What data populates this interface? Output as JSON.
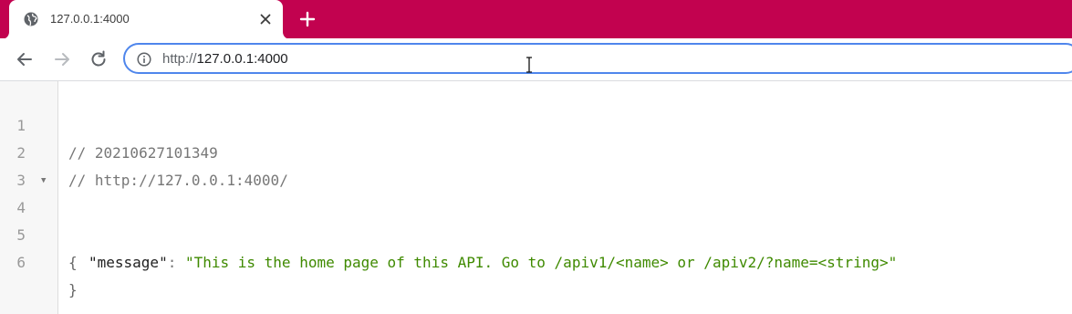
{
  "browser": {
    "accent_color": "#c2024f",
    "tab": {
      "title": "127.0.0.1:4000",
      "favicon": "globe-icon",
      "close_icon": "close-icon"
    },
    "new_tab_icon": "plus-icon",
    "toolbar": {
      "back_icon": "back-arrow-icon",
      "forward_icon": "forward-arrow-icon",
      "reload_icon": "reload-icon",
      "site_info_icon": "info-icon",
      "url_scheme": "http://",
      "url_host": "127.0.0.1:4000"
    }
  },
  "viewer": {
    "lines": [
      {
        "number": "1",
        "text": "// 20210627101349"
      },
      {
        "number": "2",
        "text": "// http://127.0.0.1:4000/"
      },
      {
        "number": "3",
        "text": ""
      },
      {
        "number": "4",
        "text": "{"
      },
      {
        "number": "5",
        "key": "\"message\"",
        "sep": ": ",
        "value": "\"This is the home page of this API. Go to /apiv1/<name> or /apiv2/?name=<string>\""
      },
      {
        "number": "6",
        "text": "}"
      }
    ],
    "fold_icon": "fold-triangle-icon"
  }
}
